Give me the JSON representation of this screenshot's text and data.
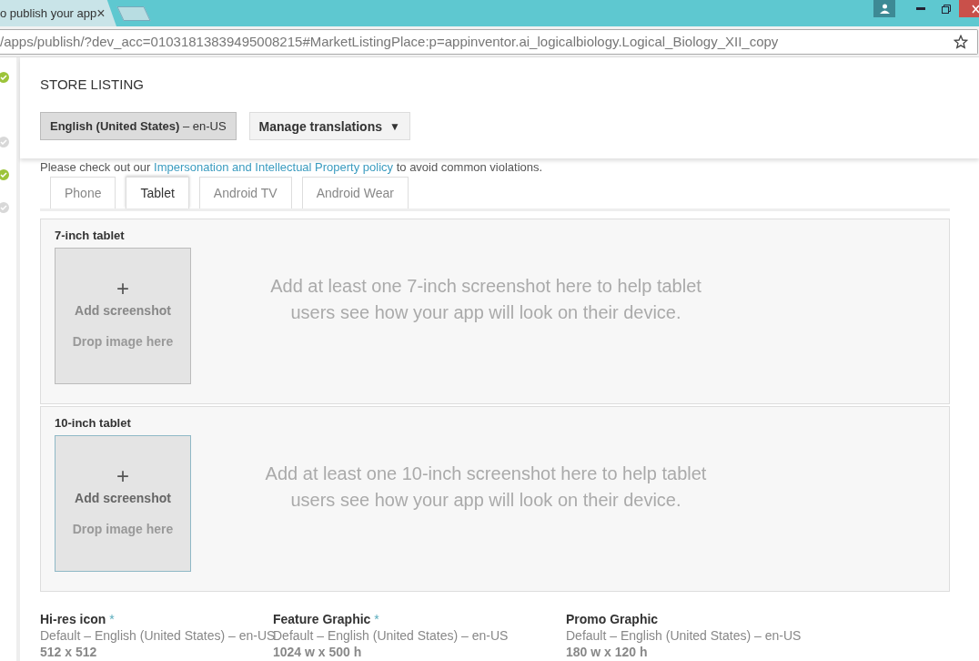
{
  "browser": {
    "tab_title": "o publish your app",
    "tab_close": "×",
    "url": "/apps/publish/?dev_acc=01031813839495008215#MarketListingPlace:p=appinventor.ai_logicalbiology.Logical_Biology_XII_copy"
  },
  "sidebar": {
    "items": [
      {
        "done": true
      },
      {
        "done": false
      },
      {
        "done": true
      },
      {
        "done": false
      }
    ]
  },
  "header": {
    "title": "STORE LISTING",
    "language_button": "**English (United States)** – en-US",
    "translations_button": "Manage translations",
    "translations_caret": "▼"
  },
  "notice": {
    "before": "Please check out our ",
    "link": "Impersonation and Intellectual Property policy",
    "after": " to avoid common violations."
  },
  "tabs": [
    {
      "label": "Phone",
      "selected": false
    },
    {
      "label": "Tablet",
      "selected": true
    },
    {
      "label": "Android TV",
      "selected": false
    },
    {
      "label": "Android Wear",
      "selected": false
    }
  ],
  "sections": [
    {
      "title": "7-inch tablet",
      "plus": "+",
      "add_label": "Add screenshot",
      "drop_label": "Drop image here",
      "hint": "Add at least one 7-inch screenshot here to help tablet users see how your app will look on their device.",
      "highlighted": false
    },
    {
      "title": "10-inch tablet",
      "plus": "+",
      "add_label": "Add screenshot",
      "drop_label": "Drop image here",
      "hint": "Add at least one 10-inch screenshot here to help tablet users see how your app will look on their device.",
      "highlighted": true
    }
  ],
  "graphics": [
    {
      "title": "Hi-res icon",
      "required_mark": "*",
      "language": "Default – English (United States) – en-US",
      "size": "512 x 512"
    },
    {
      "title": "Feature Graphic",
      "required_mark": "*",
      "language": "Default – English (United States) – en-US",
      "size": "1024 w x 500 h"
    },
    {
      "title": "Promo Graphic",
      "language": "Default – English (United States) – en-US",
      "size": "180 w x 120 h"
    }
  ]
}
